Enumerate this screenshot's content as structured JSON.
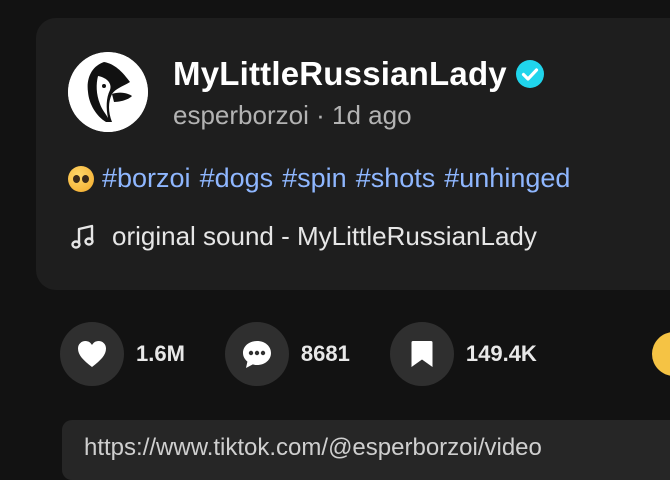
{
  "post": {
    "display_name": "MyLittleRussianLady",
    "username": "esperborzoi",
    "separator": "·",
    "age": "1d ago",
    "caption": {
      "emoji": "pleading-face-emoji",
      "hashtags": [
        "#borzoi",
        "#dogs",
        "#spin",
        "#shots",
        "#unhinged"
      ]
    },
    "sound": "original sound - MyLittleRussianLady"
  },
  "actions": {
    "likes": "1.6M",
    "comments": "8681",
    "saves": "149.4K"
  },
  "link": {
    "text": "https://www.tiktok.com/@esperborzoi/video"
  },
  "colors": {
    "background": "#121212",
    "card": "#1e1e1e",
    "hashtag": "#8fb7ff",
    "verified": "#20d5ec",
    "action_button": "#2f2f2f",
    "share": "#f5c344"
  }
}
